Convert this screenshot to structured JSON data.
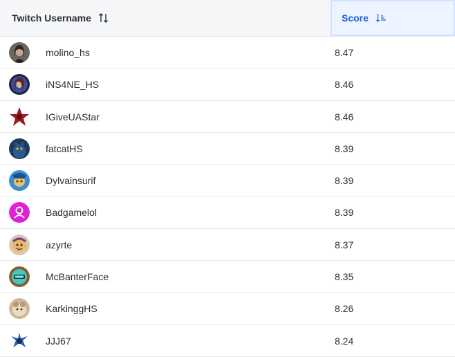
{
  "header": {
    "username_label": "Twitch Username",
    "score_label": "Score",
    "username_sort_icon": "sort-both-icon",
    "score_sort_icon": "sort-descending-icon",
    "active_color": "#1a5fd6"
  },
  "rows": [
    {
      "name": "molino_hs",
      "score": "8.47",
      "avatar": "portrait-avatar"
    },
    {
      "name": "iNS4NE_HS",
      "score": "8.46",
      "avatar": "portrait-avatar"
    },
    {
      "name": "IGiveUAStar",
      "score": "8.46",
      "avatar": "star-logo"
    },
    {
      "name": "fatcatHS",
      "score": "8.39",
      "avatar": "cat-avatar"
    },
    {
      "name": "Dylvainsurif",
      "score": "8.39",
      "avatar": "cartoon-avatar"
    },
    {
      "name": "Badgamelol",
      "score": "8.39",
      "avatar": "default-user-avatar"
    },
    {
      "name": "azyrte",
      "score": "8.37",
      "avatar": "cartoon-avatar"
    },
    {
      "name": "McBanterFace",
      "score": "8.35",
      "avatar": "badge-avatar"
    },
    {
      "name": "KarkinggHS",
      "score": "8.26",
      "avatar": "animal-avatar"
    },
    {
      "name": "JJJ67",
      "score": "8.24",
      "avatar": "creature-avatar"
    }
  ]
}
